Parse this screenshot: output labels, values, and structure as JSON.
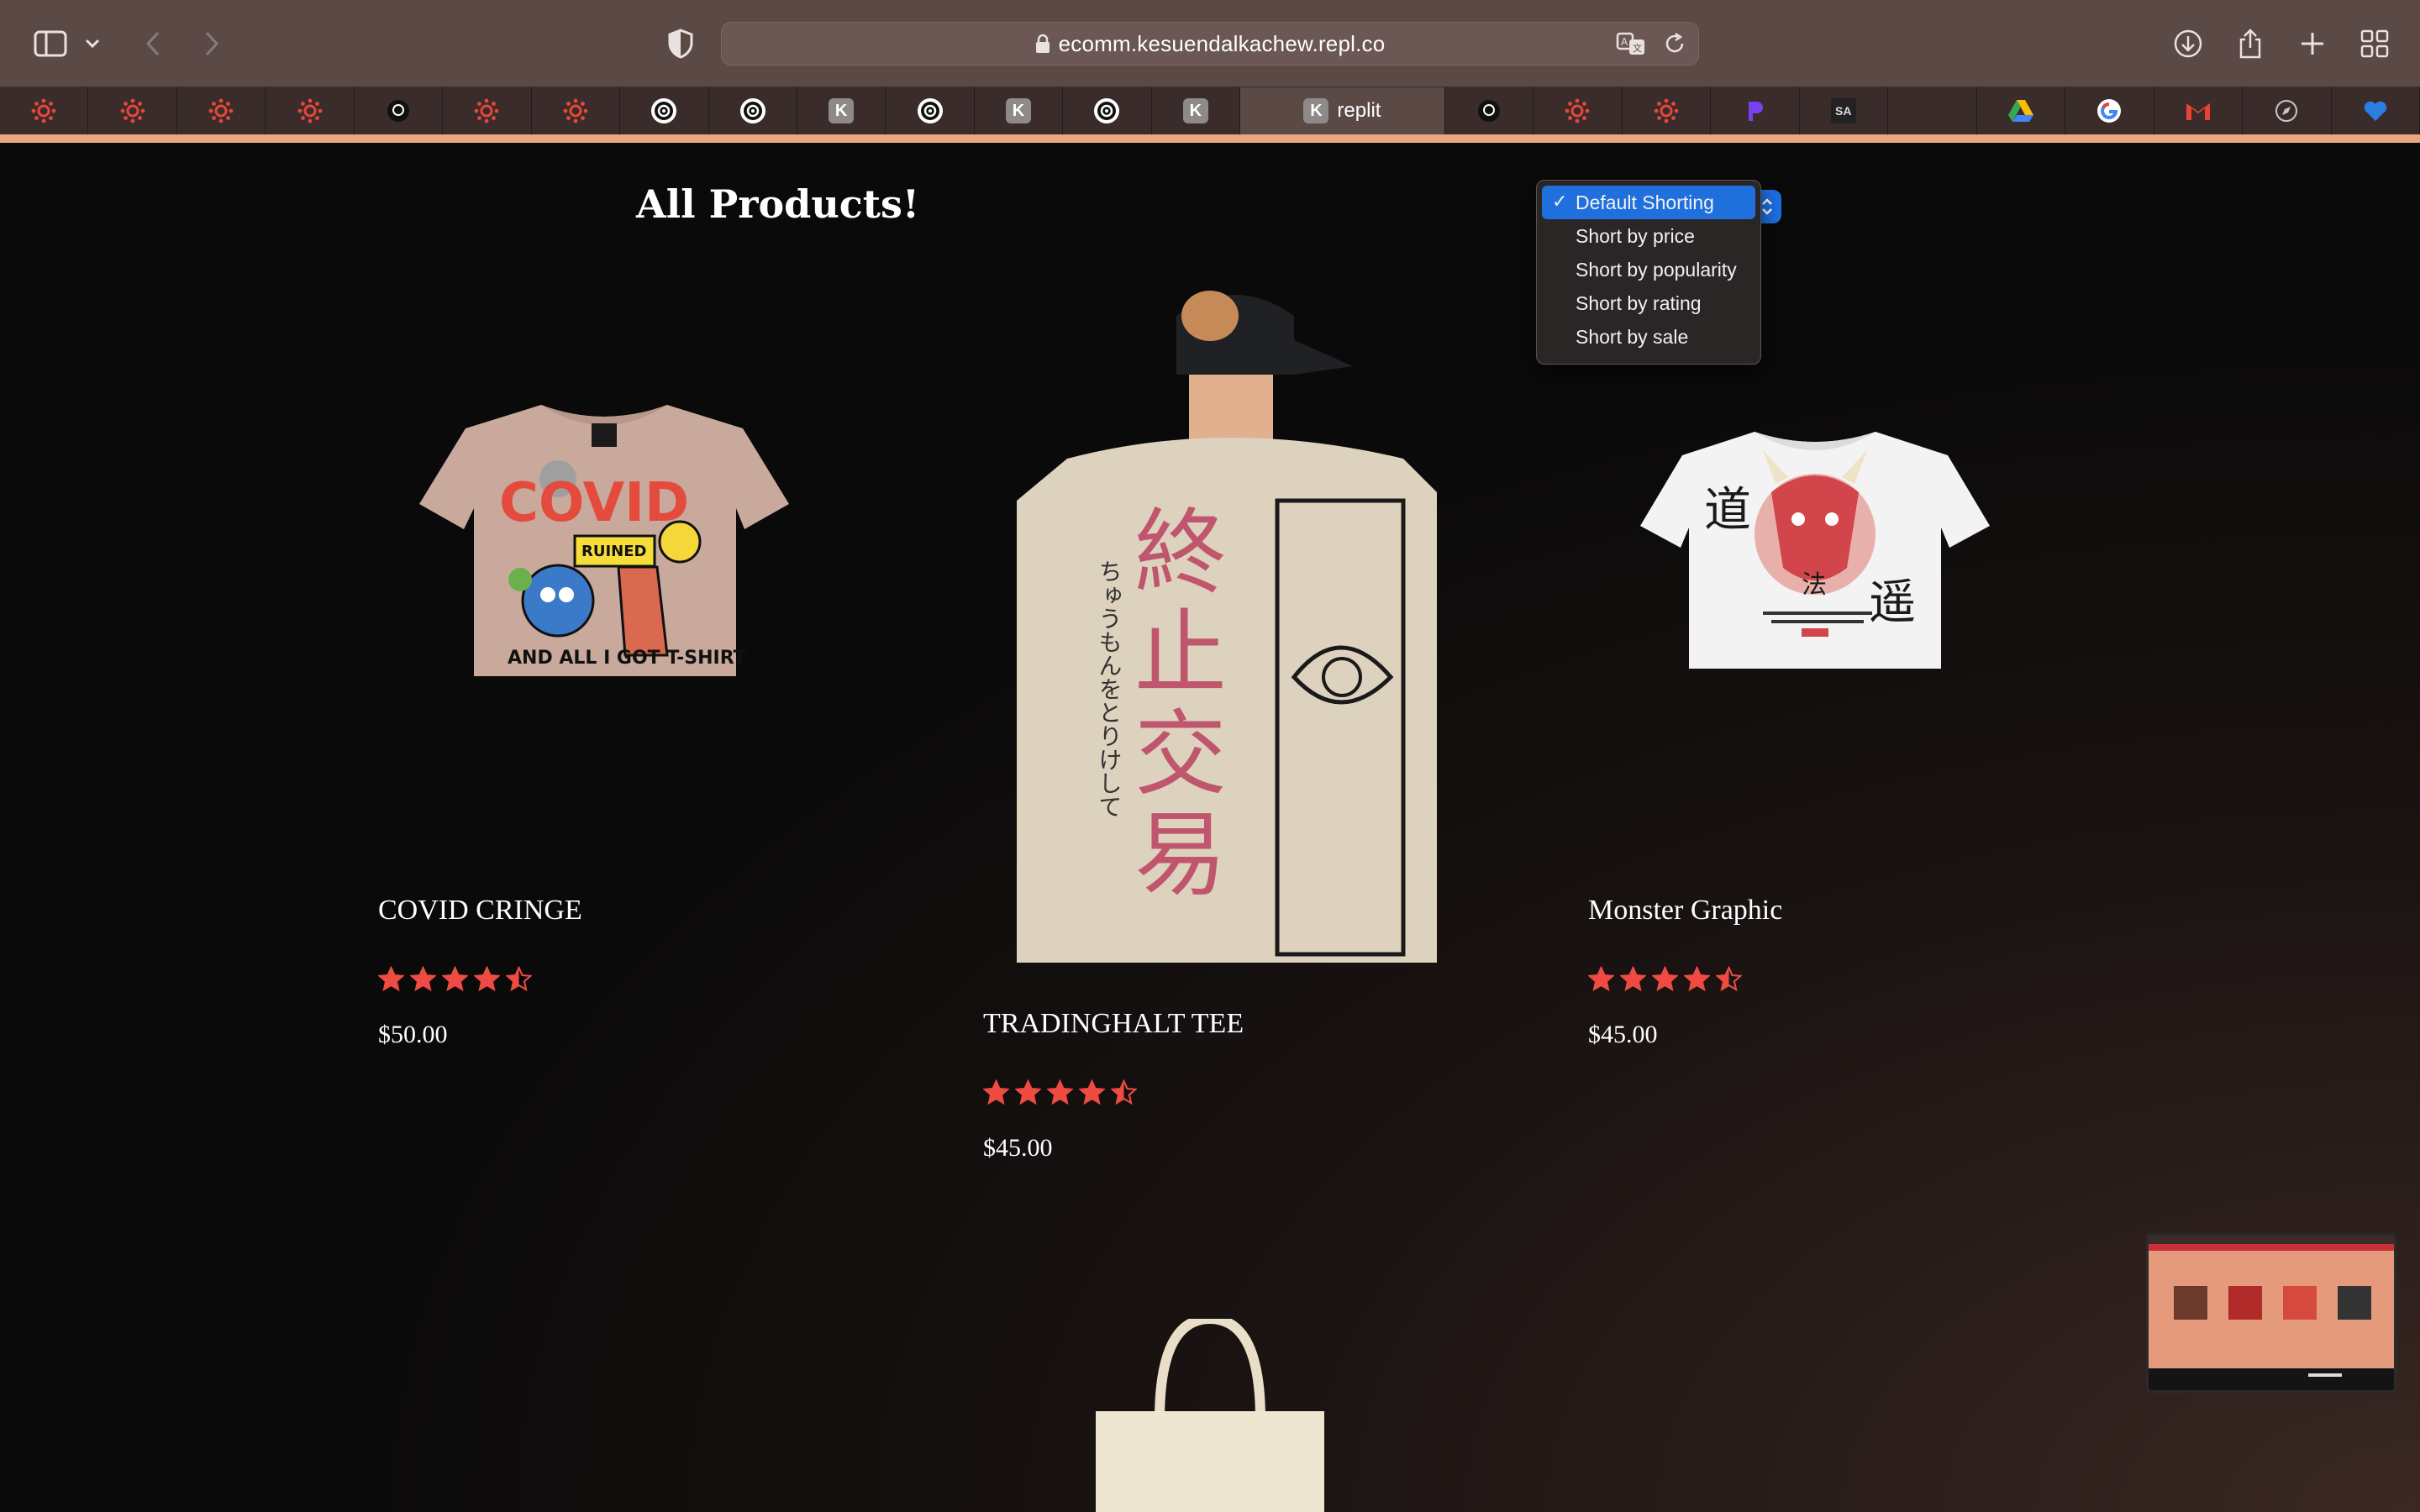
{
  "browser": {
    "url": "ecomm.kesuendalkachew.repl.co",
    "active_tab_label": "replit",
    "active_tab_icon_letter": "K",
    "tabs": [
      {
        "icon": "canvas-icon"
      },
      {
        "icon": "canvas-icon"
      },
      {
        "icon": "canvas-icon"
      },
      {
        "icon": "canvas-icon"
      },
      {
        "icon": "github-icon"
      },
      {
        "icon": "canvas-icon"
      },
      {
        "icon": "canvas-icon"
      },
      {
        "icon": "replit-swirl-icon"
      },
      {
        "icon": "replit-swirl-icon"
      },
      {
        "icon": "k-icon",
        "letter": "K"
      },
      {
        "icon": "replit-swirl-icon"
      },
      {
        "icon": "k-icon",
        "letter": "K"
      },
      {
        "icon": "replit-swirl-icon"
      },
      {
        "icon": "k-icon",
        "letter": "K"
      },
      {
        "icon": "active-tab"
      },
      {
        "icon": "github-icon"
      },
      {
        "icon": "canvas-icon"
      },
      {
        "icon": "canvas-icon"
      },
      {
        "icon": "p-logo-icon"
      },
      {
        "icon": "sa-icon",
        "letter": "SA"
      },
      {
        "icon": "blank"
      },
      {
        "icon": "google-drive-icon"
      },
      {
        "icon": "google-icon"
      },
      {
        "icon": "gmail-icon"
      },
      {
        "icon": "compass-icon"
      },
      {
        "icon": "bookmark-heart-icon"
      }
    ],
    "accent_color": "#e8a77f"
  },
  "page": {
    "title": "All Products!",
    "sort_menu": {
      "selected": "Default Shorting",
      "options": [
        "Default Shorting",
        "Short by price",
        "Short by popularity",
        "Short by rating",
        "Short by sale"
      ]
    },
    "products": [
      {
        "name": "COVID CRINGE",
        "rating": 4.5,
        "price": "$50.00"
      },
      {
        "name": "TRADINGHALT TEE",
        "rating": 4.5,
        "price": "$45.00"
      },
      {
        "name": "Monster Graphic",
        "rating": 4.5,
        "price": "$45.00"
      }
    ],
    "star_color": "#ef4b43"
  }
}
